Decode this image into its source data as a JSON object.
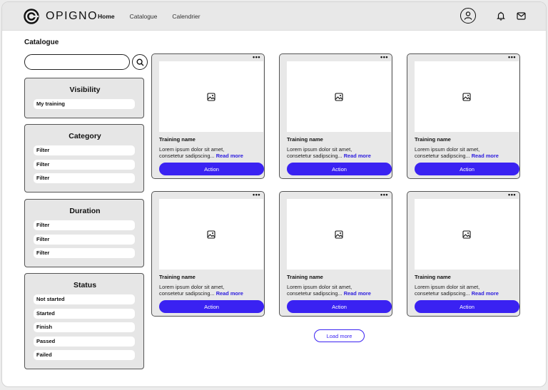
{
  "header": {
    "logo_text": "OPIGNO",
    "nav": [
      {
        "label": "Home",
        "active": true
      },
      {
        "label": "Catalogue",
        "active": false
      },
      {
        "label": "Calendrier",
        "active": false
      }
    ]
  },
  "page": {
    "title": "Catalogue"
  },
  "search": {
    "value": "",
    "placeholder": ""
  },
  "filters": [
    {
      "title": "Visibility",
      "items": [
        "My training"
      ]
    },
    {
      "title": "Category",
      "items": [
        "Filter",
        "Filter",
        "Filter"
      ]
    },
    {
      "title": "Duration",
      "items": [
        "Filter",
        "Filter",
        "Filter"
      ]
    },
    {
      "title": "Status",
      "items": [
        "Not started",
        "Started",
        "Finish",
        "Passed",
        "Failed"
      ]
    }
  ],
  "cards": [
    {
      "name": "Training name",
      "line1": "Lorem ipsum dolor sit amet,",
      "line2": "consetetur sadipscing...",
      "read_more": "Read more",
      "action": "Action",
      "menu": "•••"
    },
    {
      "name": "Training name",
      "line1": "Lorem ipsum dolor sit amet,",
      "line2": "consetetur sadipscing...",
      "read_more": "Read more",
      "action": "Action",
      "menu": "•••"
    },
    {
      "name": "Training name",
      "line1": "Lorem ipsum dolor sit amet,",
      "line2": "consetetur sadipscing...",
      "read_more": "Read more",
      "action": "Action",
      "menu": "•••"
    },
    {
      "name": "Training name",
      "line1": "Lorem ipsum dolor sit amet,",
      "line2": "consetetur sadipscing...",
      "read_more": "Read more",
      "action": "Action",
      "menu": "•••"
    },
    {
      "name": "Training name",
      "line1": "Lorem ipsum dolor sit amet,",
      "line2": "consetetur sadipscing...",
      "read_more": "Read more",
      "action": "Action",
      "menu": "•••"
    },
    {
      "name": "Training name",
      "line1": "Lorem ipsum dolor sit amet,",
      "line2": "consetetur sadipscing...",
      "read_more": "Read more",
      "action": "Action",
      "menu": "•••"
    }
  ],
  "load_more": "Load more",
  "icons": {
    "search": "search-icon",
    "user": "user-icon",
    "bell": "bell-icon",
    "mail": "mail-icon",
    "image": "image-placeholder-icon",
    "logo": "opigno-logo-icon"
  },
  "colors": {
    "accent": "#3a22f2",
    "panel": "#e6e6e6",
    "topbar": "#e8e8e8"
  }
}
